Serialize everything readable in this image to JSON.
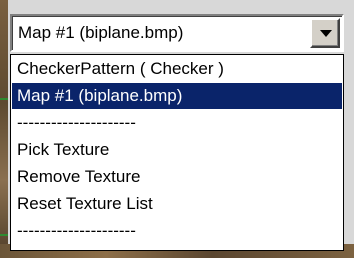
{
  "combo": {
    "value": "Map #1 (biplane.bmp)",
    "button_icon": "chevron-down-icon"
  },
  "dropdown": {
    "items": [
      {
        "label": "CheckerPattern  ( Checker )",
        "selected": false
      },
      {
        "label": "Map #1 (biplane.bmp)",
        "selected": true
      },
      {
        "label": "---------------------",
        "selected": false
      },
      {
        "label": "Pick Texture",
        "selected": false
      },
      {
        "label": "Remove Texture",
        "selected": false
      },
      {
        "label": "Reset Texture List",
        "selected": false
      },
      {
        "label": "---------------------",
        "selected": false
      }
    ],
    "selection_color": "#0a246a"
  }
}
